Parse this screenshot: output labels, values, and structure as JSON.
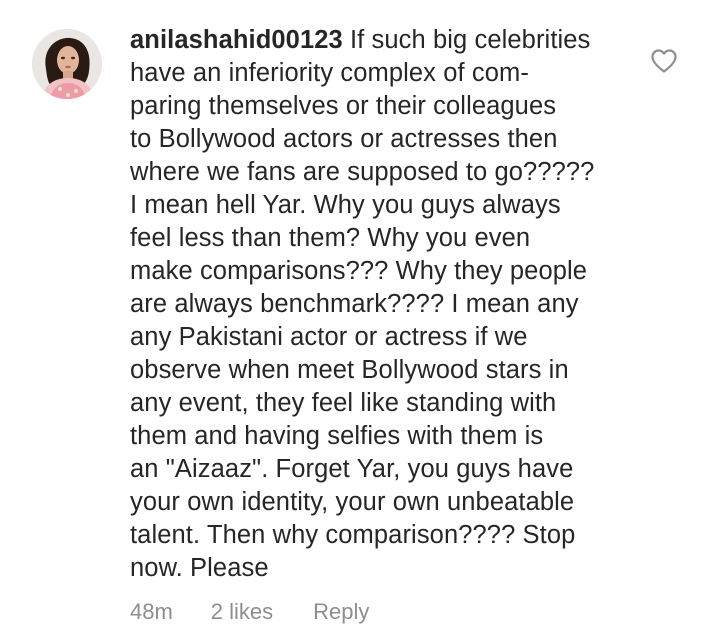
{
  "comment": {
    "username": "anilashahid00123",
    "text": " If such big celebrities\nhave an inferiority complex of com-\nparing themselves or their colleagues\nto Bollywood actors or actresses then\nwhere we fans are supposed to go?????\nI mean hell Yar. Why you guys always\nfeel less than them? Why you even\nmake comparisons??? Why they people\nare always benchmark???? I mean any\nany Pakistani actor or actress if we\nobserve when meet Bollywood stars in\nany event, they feel like standing with\nthem and having selfies with them is\nan \"Aizaaz\". Forget Yar, you guys have\nyour own identity, your own unbeatable\ntalent. Then why comparison???? Stop\nnow. Please",
    "avatar_icon": "profile-photo",
    "like_icon": "heart-outline-icon",
    "time": "48m",
    "likes": "2 likes",
    "reply_label": "Reply"
  },
  "colors": {
    "text": "#262626",
    "meta": "#8e8e8e",
    "background": "#ffffff"
  }
}
